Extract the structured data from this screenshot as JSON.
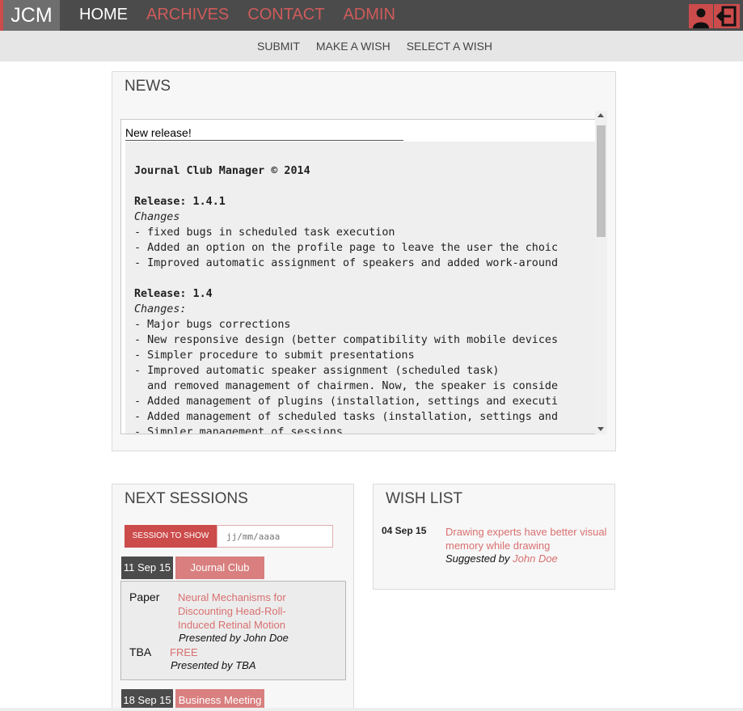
{
  "app": {
    "logo": "JCM"
  },
  "colors": {
    "accent": "#cc4b4b",
    "topbar": "#4b4b4b",
    "subnav": "#e6e6e6",
    "link": "#d97070"
  },
  "nav": {
    "items": [
      {
        "label": "HOME",
        "active": true
      },
      {
        "label": "ARCHIVES",
        "active": false
      },
      {
        "label": "CONTACT",
        "active": false
      },
      {
        "label": "ADMIN",
        "active": false
      }
    ],
    "icons": [
      "user-icon",
      "logout-icon"
    ]
  },
  "subnav": {
    "items": [
      "SUBMIT",
      "MAKE A WISH",
      "SELECT A WISH"
    ]
  },
  "news": {
    "title": "NEWS",
    "item_title": "New release!",
    "content": {
      "heading": "Journal Club Manager © 2014",
      "releases": [
        {
          "label": "Release: 1.4.1",
          "changes_label": "Changes",
          "lines": [
            "- fixed bugs in scheduled task execution",
            "- Added an option on the profile page to leave the user the choic",
            "- Improved automatic assignment of speakers and added work-around"
          ]
        },
        {
          "label": "Release: 1.4",
          "changes_label": "Changes:",
          "lines": [
            "- Major bugs corrections",
            "- New responsive design (better compatibility with mobile devices",
            "- Simpler procedure to submit presentations",
            "- Improved automatic speaker assignment (scheduled task)",
            "  and removed management of chairmen. Now, the speaker is conside",
            "- Added management of plugins (installation, settings and executi",
            "- Added management of scheduled tasks (installation, settings and",
            "- Simpler management of sessions"
          ]
        }
      ]
    }
  },
  "sessions": {
    "title": "NEXT SESSIONS",
    "filter_label": "SESSION TO SHOW",
    "filter_placeholder": "jj/mm/aaaa",
    "items": [
      {
        "date": "11 Sep 15",
        "type": "Journal Club",
        "entries": [
          {
            "kind": "Paper",
            "title": "Neural Mechanisms for Discounting Head-Roll-Induced Retinal Motion",
            "presenter": "Presented by John Doe"
          },
          {
            "kind": "TBA",
            "title": "FREE",
            "presenter": "Presented by TBA"
          }
        ]
      },
      {
        "date": "18 Sep 15",
        "type": "Business Meeting"
      }
    ]
  },
  "wishlist": {
    "title": "WISH LIST",
    "items": [
      {
        "date": "04 Sep 15",
        "title": "Drawing experts have better visual memory while drawing",
        "suggested_prefix": "Suggested by",
        "author": "John Doe"
      }
    ]
  }
}
